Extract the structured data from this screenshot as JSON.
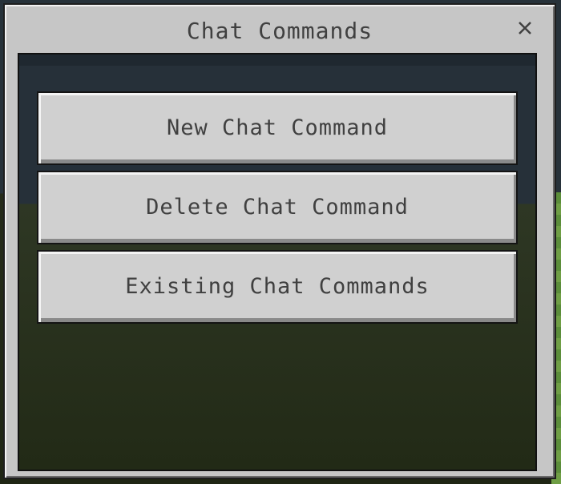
{
  "dialog": {
    "title": "Chat Commands",
    "close_icon": "close-icon"
  },
  "buttons": [
    {
      "label": "New Chat Command"
    },
    {
      "label": "Delete Chat Command"
    },
    {
      "label": "Existing Chat Commands"
    }
  ],
  "colors": {
    "panel": "#c6c6c6",
    "button": "#d0d0d0",
    "text": "#404040",
    "border": "#141414"
  }
}
